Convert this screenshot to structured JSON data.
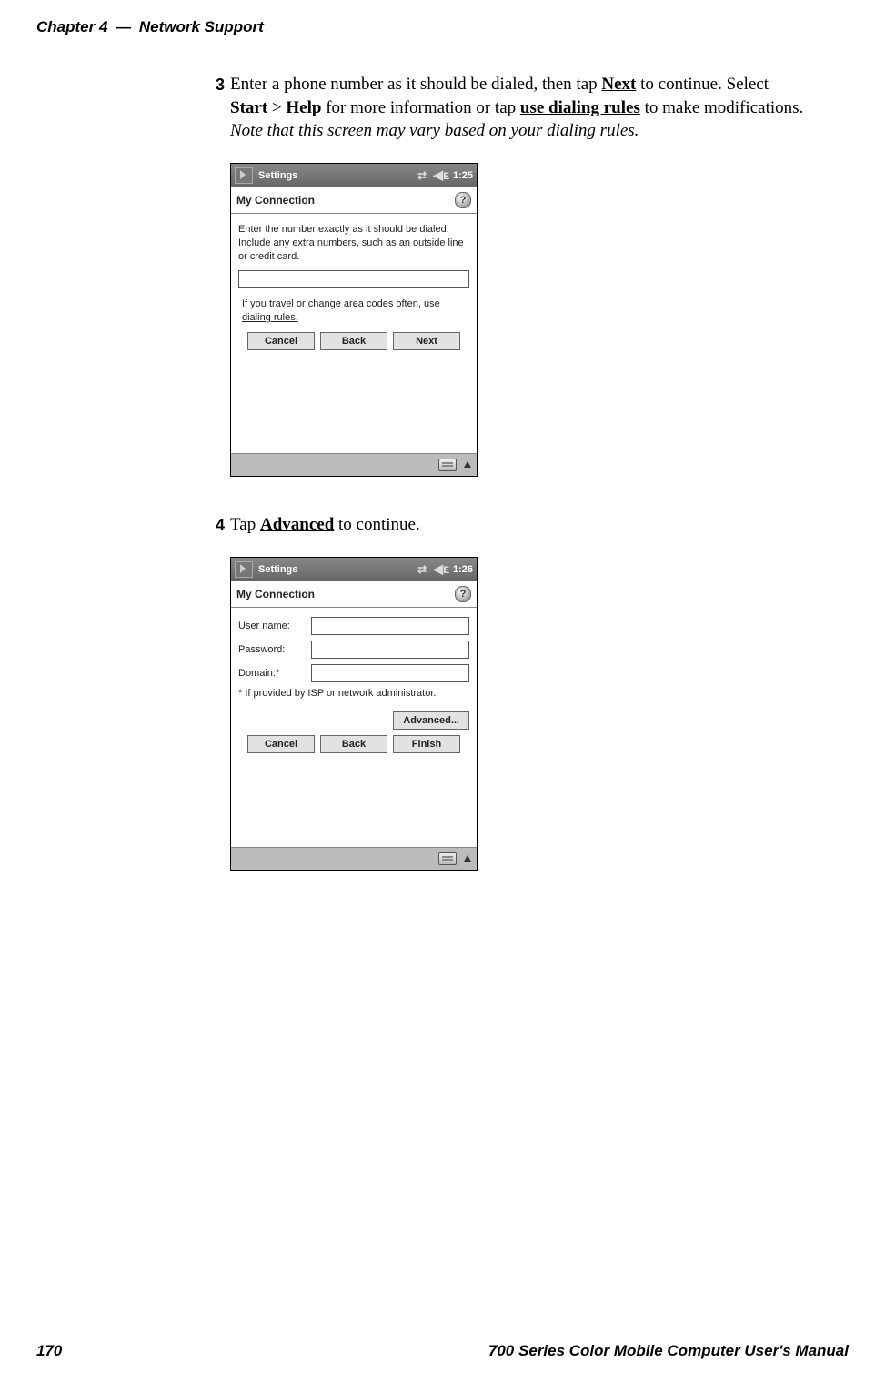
{
  "header": {
    "chapter": "Chapter 4",
    "dash": "—",
    "title": "Network Support"
  },
  "steps": {
    "s3": {
      "num": "3",
      "p1a": "Enter a phone number as it should be dialed, then tap ",
      "next": "Next",
      "p1b": " to continue. Select ",
      "start": "Start",
      "gt": " > ",
      "help": "Help",
      "p1c": " for more information or tap ",
      "usedial": "use dialing rules",
      "p1d": " to make modifications. ",
      "note": "Note that this screen may vary based on your dialing rules."
    },
    "s4": {
      "num": "4",
      "p1a": "Tap ",
      "adv": "Advanced",
      "p1b": " to continue."
    }
  },
  "ss1": {
    "topbar_title": "Settings",
    "time": "1:25",
    "title": "My Connection",
    "help_glyph": "?",
    "instr": "Enter the number exactly as it should be dialed.  Include any extra numbers, such as an outside line or credit card.",
    "hint_a": "If you travel or change area codes often, ",
    "hint_link": "use dialing rules.",
    "btn_cancel": "Cancel",
    "btn_back": "Back",
    "btn_next": "Next"
  },
  "ss2": {
    "topbar_title": "Settings",
    "time": "1:26",
    "title": "My Connection",
    "help_glyph": "?",
    "lbl_user": "User name:",
    "lbl_pass": "Password:",
    "lbl_domain": "Domain:*",
    "footnote": "* If provided by ISP or network administrator.",
    "btn_advanced": "Advanced...",
    "btn_cancel": "Cancel",
    "btn_back": "Back",
    "btn_finish": "Finish"
  },
  "footer": {
    "pagenum": "170",
    "title": "700 Series Color Mobile Computer User's Manual"
  }
}
